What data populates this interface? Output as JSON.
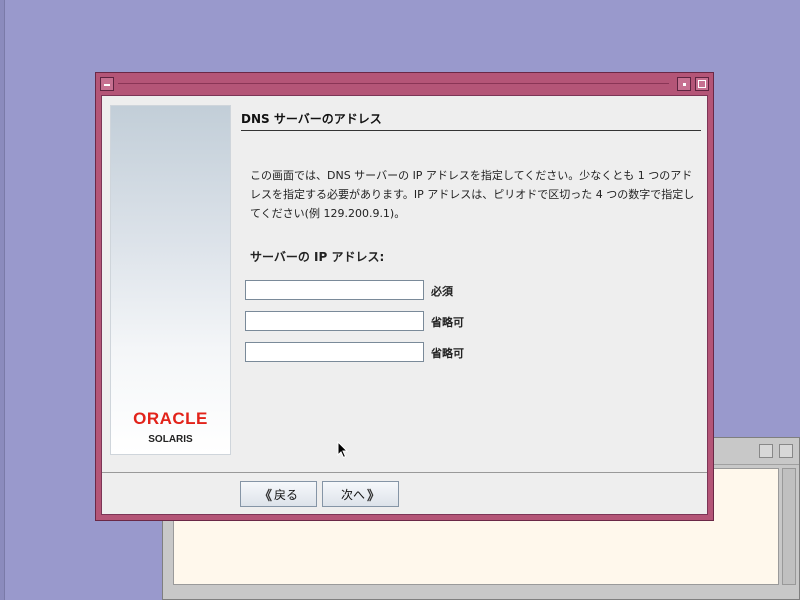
{
  "dialog": {
    "heading": "DNS サーバーのアドレス",
    "description": "この画面では、DNS サーバーの IP アドレスを指定してください。少なくとも 1 つのアドレスを指定する必要があります。IP アドレスは、ピリオドで区切った 4 つの数字で指定してください(例 129.200.9.1)。",
    "section_label": "サーバーの IP アドレス:",
    "fields": [
      {
        "value": "",
        "tag": "必須"
      },
      {
        "value": "",
        "tag": "省略可"
      },
      {
        "value": "",
        "tag": "省略可"
      }
    ],
    "back_label": "戻る",
    "next_label": "次へ"
  },
  "branding": {
    "oracle": "ORACLE",
    "solaris": "SOLARIS",
    "oracle_color": "#e2231a"
  },
  "colors": {
    "desktop": "#9999cc",
    "titlebar": "#b45577"
  }
}
